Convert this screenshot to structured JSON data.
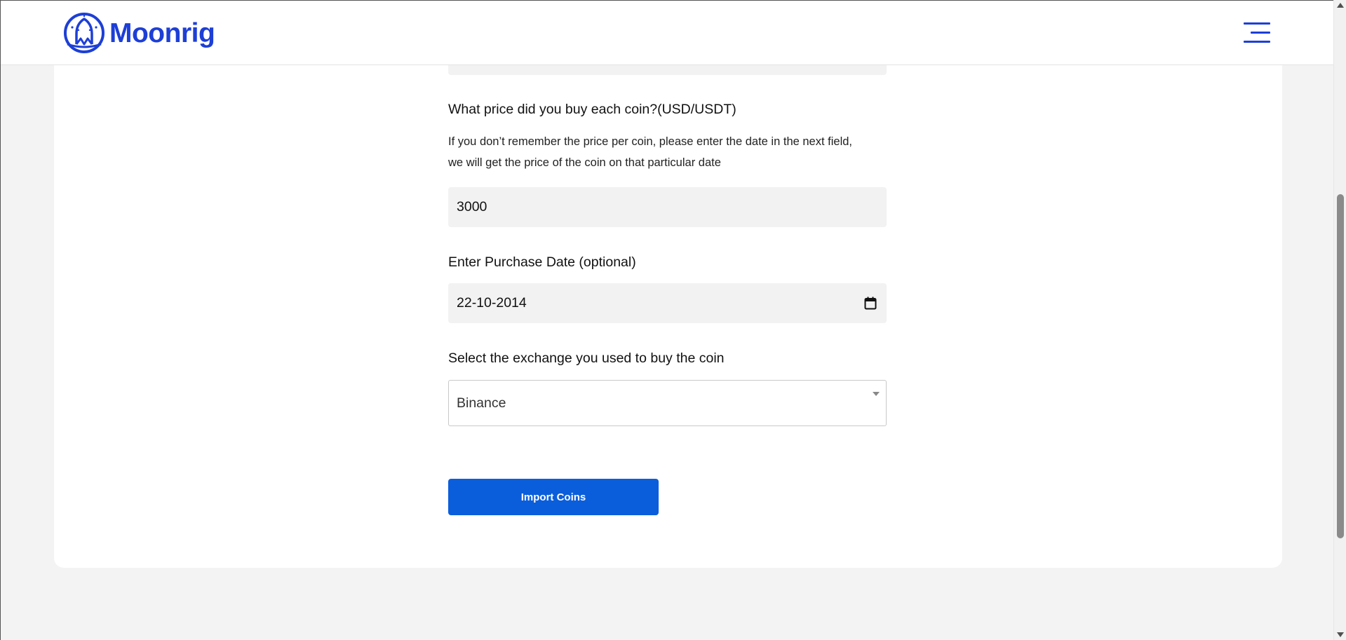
{
  "header": {
    "logo_text": "Moonrig",
    "menu_icon": "hamburger-menu-icon",
    "brand_color": "#1d3fd6"
  },
  "form": {
    "price": {
      "label": "What price did you buy each coin?(USD/USDT)",
      "help_line1": "If you don’t remember the price per coin, please enter the date in the next field,",
      "help_line2": "we will get the price of the coin on that particular date",
      "value": "3000"
    },
    "purchase_date": {
      "label": "Enter Purchase Date (optional)",
      "value": "22-10-2014",
      "icon": "calendar-icon"
    },
    "exchange": {
      "label": "Select the exchange you used to buy the coin",
      "selected": "Binance",
      "icon": "chevron-down-icon"
    },
    "submit": {
      "label": "Import Coins",
      "color": "#0b5edb"
    }
  },
  "colors": {
    "page_background": "#f3f3f3",
    "input_background": "#f2f2f2"
  }
}
